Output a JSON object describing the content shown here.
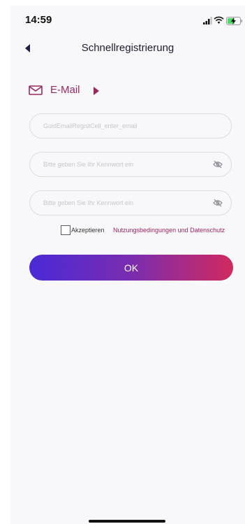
{
  "status_bar": {
    "time": "14:59",
    "signal_icon": "signal-icon",
    "wifi_icon": "wifi-icon",
    "battery_icon": "battery-charging-icon"
  },
  "nav": {
    "back_icon": "back-icon",
    "title": "Schnellregistrierung"
  },
  "tab": {
    "icon": "mail-icon",
    "label": "E-Mail",
    "arrow_icon": "triangle-right-icon"
  },
  "form": {
    "email_placeholder": "GuidEmailRegistCell_enter_email",
    "password_placeholder": "Bitte geben Sie Ihr Kennwort ein",
    "confirm_password_placeholder": "Bitte geben Sie Ihr Kennwort ein",
    "eye_icon": "eye-off-icon"
  },
  "terms": {
    "checked": false,
    "prefix": "Akzeptieren",
    "link": "Nutzungsbedingungen und Datenschutz"
  },
  "submit": {
    "label": "OK"
  },
  "colors": {
    "accent": "#9a2860",
    "link": "#a3225e",
    "gradient_start": "#4a2ad6",
    "gradient_end": "#d12a5e",
    "background": "#f8f8fa"
  }
}
